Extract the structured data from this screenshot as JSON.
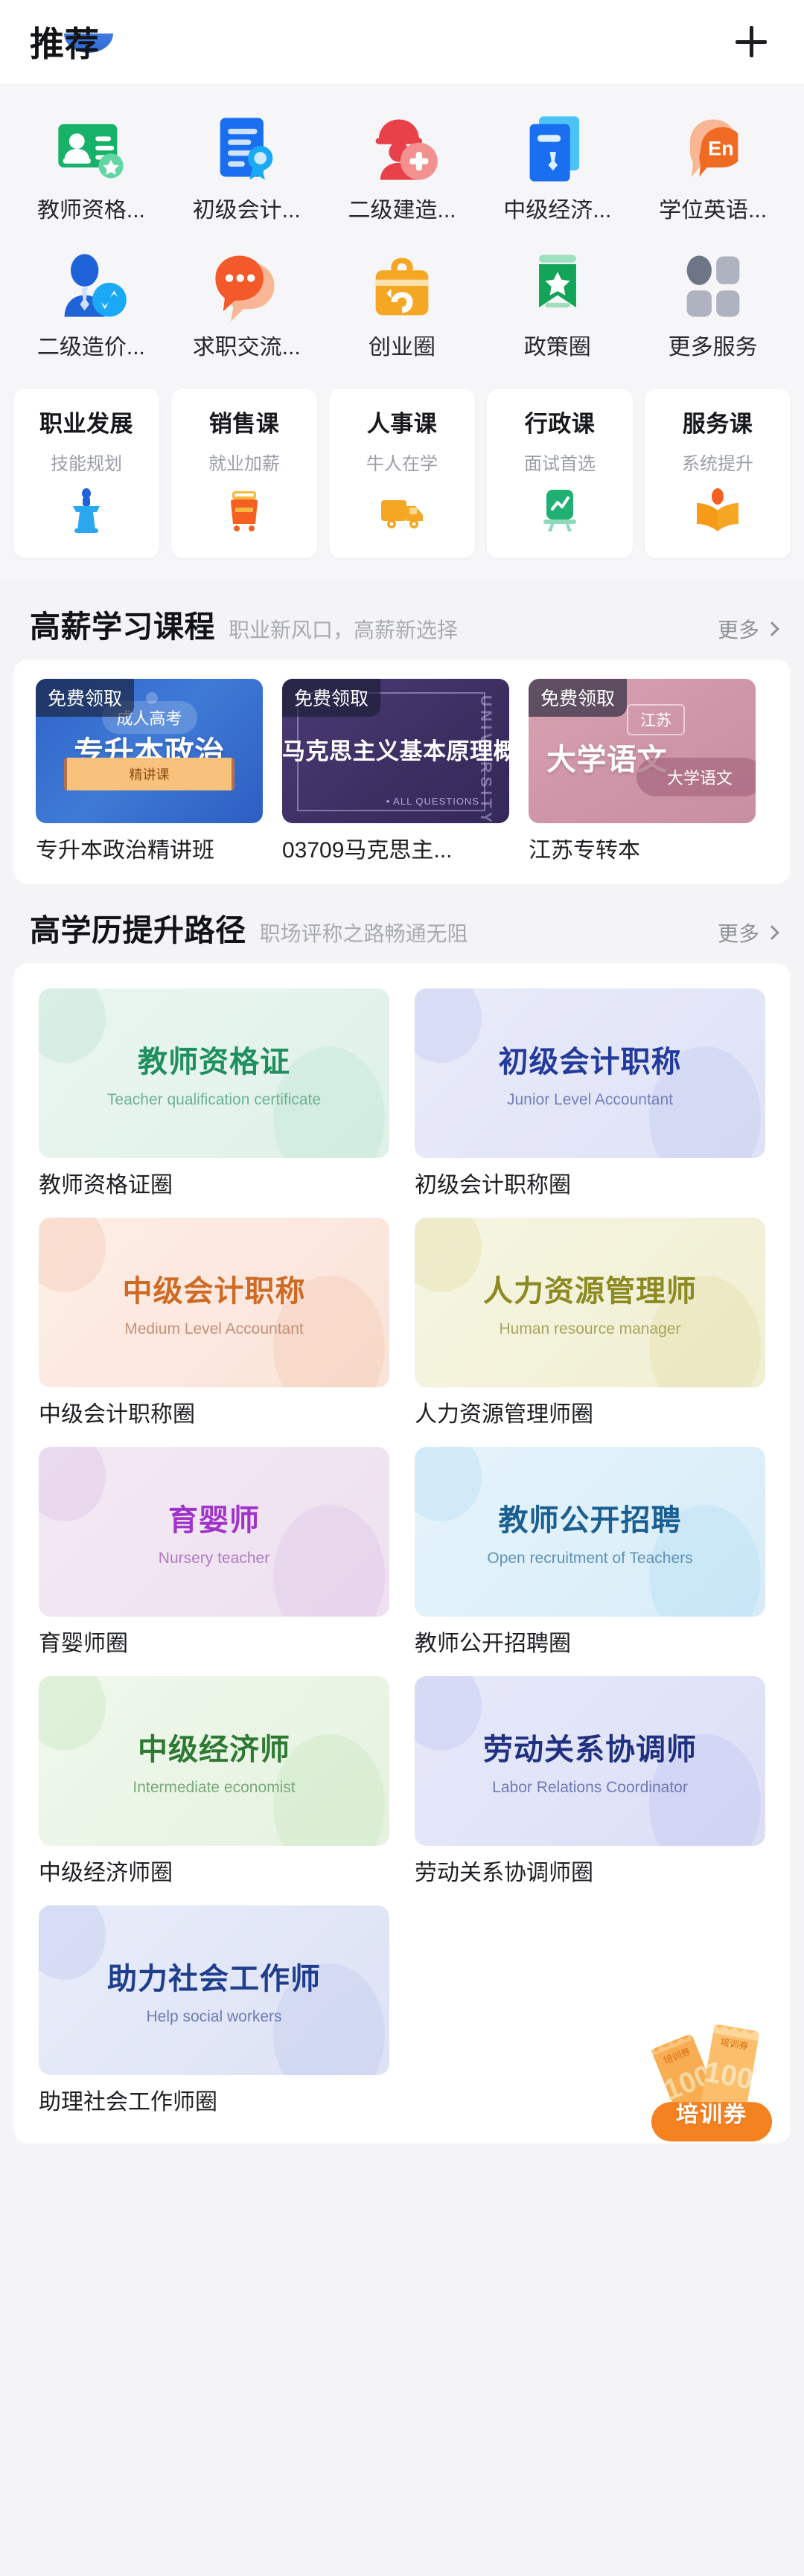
{
  "header": {
    "title": "推荐",
    "add_button": "+"
  },
  "quick_icons": [
    {
      "label": "教师资格...",
      "icon": "teacher-certificate-icon",
      "color": "#17b26a"
    },
    {
      "label": "初级会计...",
      "icon": "accounting-certificate-icon",
      "color": "#1a6ef0"
    },
    {
      "label": "二级建造...",
      "icon": "construction-engineer-icon",
      "color": "#e8414a"
    },
    {
      "label": "中级经济...",
      "icon": "economist-document-icon",
      "color": "#1a9ef0"
    },
    {
      "label": "学位英语...",
      "icon": "english-degree-icon",
      "color": "#ef6a22"
    },
    {
      "label": "二级造价...",
      "icon": "cost-engineer-icon",
      "color": "#1f63d8"
    },
    {
      "label": "求职交流...",
      "icon": "job-chat-icon",
      "color": "#f4592a"
    },
    {
      "label": "创业圈",
      "icon": "startup-briefcase-icon",
      "color": "#f5a623"
    },
    {
      "label": "政策圈",
      "icon": "policy-banner-icon",
      "color": "#12a558"
    },
    {
      "label": "更多服务",
      "icon": "more-services-grid-icon",
      "color": "#9ea3ad"
    }
  ],
  "category_cards": [
    {
      "title": "职业发展",
      "subtitle": "技能规划",
      "icon": "podium-speaker-icon",
      "color": "#2aa7ef"
    },
    {
      "title": "销售课",
      "subtitle": "就业加薪",
      "icon": "sales-cart-icon",
      "color": "#f4601f"
    },
    {
      "title": "人事课",
      "subtitle": "牛人在学",
      "icon": "delivery-truck-icon",
      "color": "#f5a623"
    },
    {
      "title": "行政课",
      "subtitle": "面试首选",
      "icon": "growth-chart-icon",
      "color": "#1fb072"
    },
    {
      "title": "服务课",
      "subtitle": "系统提升",
      "icon": "open-book-icon",
      "color": "#f59b18"
    }
  ],
  "sections": [
    {
      "id": "high-salary-courses",
      "title": "高薪学习课程",
      "subtitle": "职业新风口，高薪新选择",
      "more": "更多"
    },
    {
      "id": "degree-upgrade-path",
      "title": "高学历提升路径",
      "subtitle": "职场评称之路畅通无阻",
      "more": "更多"
    }
  ],
  "courses": [
    {
      "badge": "免费领取",
      "pill": "成人高考",
      "thumb_title": "专升本政治",
      "cta": "精讲课",
      "name": "专升本政治精讲班",
      "theme": "blue"
    },
    {
      "badge": "免费领取",
      "pill": "",
      "thumb_title": "马克思主义基本原理概论",
      "vertical_text": "UNIVERSITY",
      "corner_text": "• ALL QUESTIONS",
      "cta": "",
      "name": "03709马克思主...",
      "theme": "purple"
    },
    {
      "badge": "免费领取",
      "pill": "江苏",
      "thumb_title": "大学语文",
      "cta": "大学语文",
      "name": "江苏专转本",
      "theme": "pink"
    }
  ],
  "certificates": [
    {
      "cn": "教师资格证",
      "en": "Teacher qualification certificate",
      "label": "教师资格证圈",
      "bg": "#dff1e8",
      "bg2": "#eaf6f0",
      "text": "#1f8f5f",
      "sub": "#6fb395",
      "blob": "#c4e7d6"
    },
    {
      "cn": "初级会计职称",
      "en": "Junior Level Accountant",
      "label": "初级会计职称圈",
      "bg": "#dfe2f6",
      "bg2": "#e9ebfa",
      "text": "#233b9c",
      "sub": "#7480bb",
      "blob": "#c6ccf0"
    },
    {
      "cn": "中级会计职称",
      "en": "Medium Level Accountant",
      "label": "中级会计职称圈",
      "bg": "#fae3d8",
      "bg2": "#fdeee6",
      "text": "#cf6a24",
      "sub": "#c59179",
      "blob": "#f5cdb8"
    },
    {
      "cn": "人力资源管理师",
      "en": "Human resource manager",
      "label": "人力资源管理师圈",
      "bg": "#f0efd2",
      "bg2": "#f6f5e2",
      "text": "#8c8a20",
      "sub": "#a8a45e",
      "blob": "#e4e1ae"
    },
    {
      "cn": "育婴师",
      "en": "Nursery teacher",
      "label": "育婴师圈",
      "bg": "#eee0f0",
      "bg2": "#f3e9f4",
      "text": "#a034c9",
      "sub": "#b07bc2",
      "blob": "#e0c8e8"
    },
    {
      "cn": "教师公开招聘",
      "en": "Open recruitment of Teachers",
      "label": "教师公开招聘圈",
      "bg": "#d7ecf8",
      "bg2": "#e6f4fb",
      "text": "#1a5f91",
      "sub": "#5f92b5",
      "blob": "#b9dff3"
    },
    {
      "cn": "中级经济师",
      "en": "Intermediate economist",
      "label": "中级经济师圈",
      "bg": "#e5f2e0",
      "bg2": "#eff8ec",
      "text": "#2f7a33",
      "sub": "#7aa87c",
      "blob": "#cbe8c4"
    },
    {
      "cn": "劳动关系协调师",
      "en": "Labor Relations Coordinator",
      "label": "劳动关系协调师圈",
      "bg": "#dcdef6",
      "bg2": "#e7e9fa",
      "text": "#1f3180",
      "sub": "#6f79b4",
      "blob": "#c3c7ef"
    },
    {
      "cn": "助力社会工作师",
      "en": "Help social workers",
      "label": "助理社会工作师圈",
      "bg": "#dde2f5",
      "bg2": "#e8ecfa",
      "text": "#1f3e8e",
      "sub": "#6d7cb5",
      "blob": "#c4ccee"
    }
  ],
  "coupon": {
    "label": "培训券",
    "ticket_label": "培训券",
    "ticket_value": "100",
    "color": "#f58220"
  }
}
